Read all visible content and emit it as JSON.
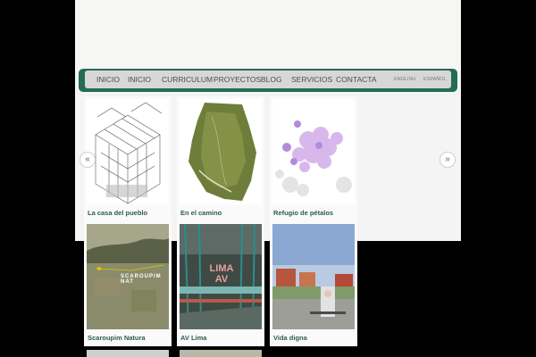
{
  "nav": {
    "items": [
      "INICIO",
      "INICIO",
      "CURRICULUM",
      "PROYECTOS",
      "BLOG",
      "SERVICIOS",
      "CONTACTA"
    ],
    "languages": [
      "ENGLISH",
      "ESPAÑOL"
    ]
  },
  "carousel": {
    "prev_icon": "«",
    "next_icon": "»"
  },
  "projects": [
    {
      "title": "La casa del pueblo",
      "image_icon": "axonometric-drawing"
    },
    {
      "title": "En el camino",
      "image_icon": "aerial-map"
    },
    {
      "title": "Refugio de pétalos",
      "image_icon": "petal-diagram"
    },
    {
      "title": "Scaroupim Natura",
      "image_icon": "satellite-photo",
      "image_text": "SCAROUPIM NAT"
    },
    {
      "title": "AV Lima",
      "image_icon": "station-render",
      "image_text": "LIMA AV"
    },
    {
      "title": "Vida digna",
      "image_icon": "residence-render"
    }
  ],
  "colors": {
    "nav_frame": "#226d53",
    "nav_bar": "#d7d7d7",
    "caption": "#2c5c50",
    "background": "#000000",
    "page": "#f4f4f4"
  }
}
